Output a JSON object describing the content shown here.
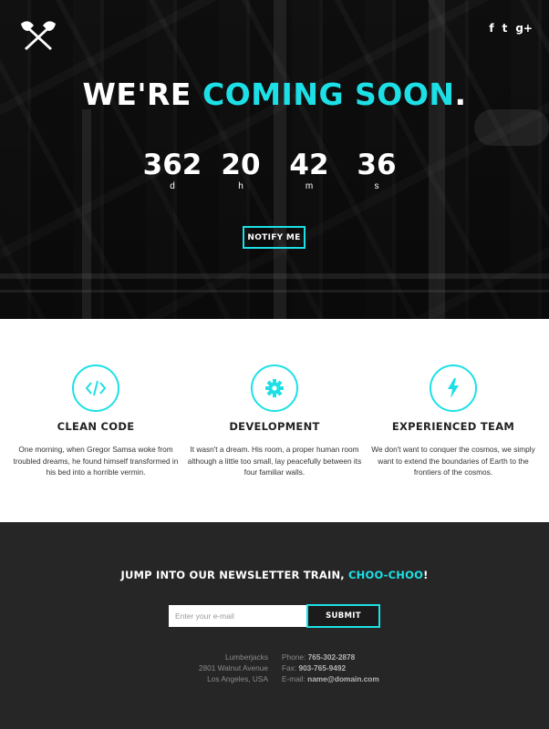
{
  "hero": {
    "headline_white": "WE'RE ",
    "headline_accent": "COMING SOON",
    "headline_period": ".",
    "countdown": [
      {
        "value": "362",
        "unit": "d"
      },
      {
        "value": "20",
        "unit": "h"
      },
      {
        "value": "42",
        "unit": "m"
      },
      {
        "value": "36",
        "unit": "s"
      }
    ],
    "notify_label": "NOTIFY ME",
    "logo_icon": "crossed-axes-icon",
    "social": [
      {
        "icon": "facebook-icon",
        "glyph": "f"
      },
      {
        "icon": "twitter-icon",
        "glyph": "t"
      },
      {
        "icon": "google-plus-icon",
        "glyph": "g+"
      }
    ]
  },
  "features": [
    {
      "icon": "code-icon",
      "title": "CLEAN CODE",
      "text": "One morning, when Gregor Samsa woke from troubled dreams, he found himself transformed in his bed into a horrible vermin."
    },
    {
      "icon": "gear-icon",
      "title": "DEVELOPMENT",
      "text": "It wasn't a dream. His room, a proper human room although a little too small, lay peacefully between its four familiar walls."
    },
    {
      "icon": "lightning-icon",
      "title": "EXPERIENCED TEAM",
      "text": "We don't want to conquer the cosmos, we simply want to extend the boundaries of Earth to the frontiers of the cosmos."
    }
  ],
  "newsletter": {
    "title_white": "JUMP INTO OUR NEWSLETTER TRAIN, ",
    "title_accent": "CHOO-CHOO",
    "title_end": "!",
    "email_placeholder": "Enter your e-mail",
    "submit_label": "SUBMIT"
  },
  "footer": {
    "address": [
      "Lumberjacks",
      "2801 Walnut Avenue",
      "Los Angeles, USA"
    ],
    "contact": [
      {
        "label": "Phone: ",
        "value": "765-302-2878"
      },
      {
        "label": "Fax: ",
        "value": "903-765-9492"
      },
      {
        "label": "E-mail: ",
        "value": "name@domain.com"
      }
    ]
  },
  "colors": {
    "accent": "#1de0e6",
    "dark": "#262626"
  }
}
